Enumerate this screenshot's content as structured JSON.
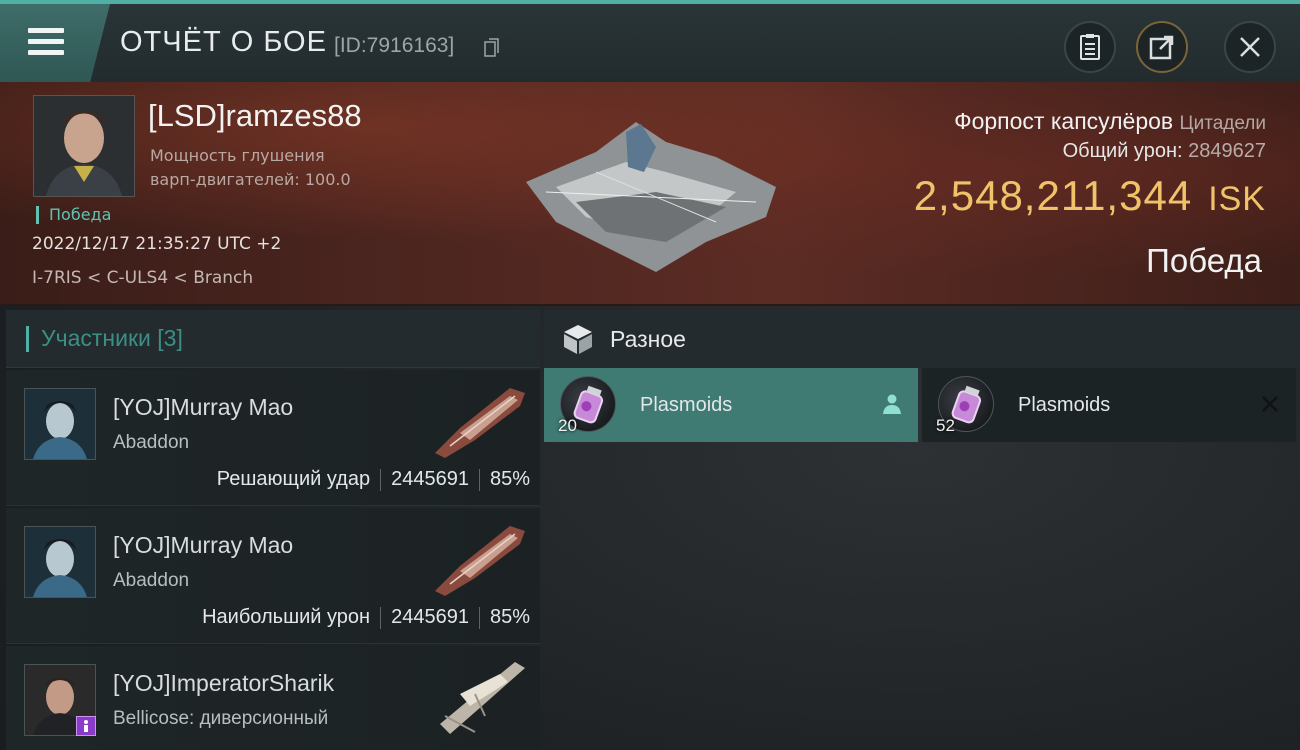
{
  "header": {
    "title": "ОТЧЁТ О БОЕ",
    "report_id": "[ID:7916163]",
    "icons": [
      "menu-icon",
      "copy-icon",
      "report-icon",
      "share-icon",
      "close-icon"
    ]
  },
  "victim": {
    "pilot_name": "[LSD]ramzes88",
    "attribute_line1": "Мощность глушения",
    "attribute_line2": "варп-двигателей: 100.0",
    "status": "Победа",
    "datetime": "2022/12/17 21:35:27 UTC +2",
    "location": "I-7RIS < C-ULS4 < Branch",
    "target_name": "Форпост капсулёров",
    "target_category": "Цитадели",
    "total_damage_label": "Общий урон:",
    "total_damage_value": "2849627",
    "isk_value": "2,548,211,344",
    "isk_unit": "ISK",
    "result": "Победа"
  },
  "participants": {
    "title": "Участники [3]",
    "list": [
      {
        "name": "[YOJ]Murray Mao",
        "ship": "Abaddon",
        "role": "Решающий удар",
        "damage": "2445691",
        "percent": "85%"
      },
      {
        "name": "[YOJ]Murray Mao",
        "ship": "Abaddon",
        "role": "Наибольший урон",
        "damage": "2445691",
        "percent": "85%"
      },
      {
        "name": "[YOJ]ImperatorSharik",
        "ship": "Bellicose: диверсионный"
      }
    ]
  },
  "misc": {
    "title": "Разное",
    "items": [
      {
        "name": "Plasmoids",
        "quantity": "20",
        "state": "dropped",
        "trail_icon": "person-icon"
      },
      {
        "name": "Plasmoids",
        "quantity": "52",
        "state": "destroyed",
        "trail_icon": "x-icon"
      }
    ]
  },
  "colors": {
    "accent": "#4fb0a3",
    "isk": "#f0c36a",
    "selected_item": "#3f7a73"
  }
}
